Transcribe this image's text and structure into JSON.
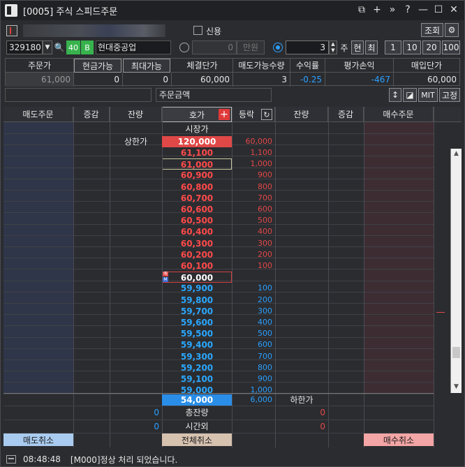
{
  "window": {
    "id": "[0005]",
    "title": "주식 스피드주문"
  },
  "toolbar": {
    "credit_label": "신용",
    "query_button": "조회"
  },
  "stock": {
    "code": "329180",
    "badge_margin": "40",
    "badge_type": "B",
    "name": "현대중공업"
  },
  "order_input": {
    "amount_value": "0",
    "amount_unit": "만원",
    "qty_value": "3",
    "qty_unit": "주",
    "btn_current": "현",
    "btn_max": "최",
    "qty_presets": [
      "1",
      "10",
      "20",
      "100"
    ]
  },
  "summary": {
    "headers": [
      "주문가",
      "현금가능",
      "최대가능",
      "체결단가",
      "매도가능수량",
      "수익률",
      "평가손익",
      "매입단가"
    ],
    "values": [
      "61,000",
      "0",
      "0",
      "60,000",
      "3",
      "-0.25",
      "-467",
      "60,000"
    ]
  },
  "order_amount_label": "주문금액",
  "mode_buttons": [
    "MIT",
    "고정"
  ],
  "grid": {
    "headers": [
      "매도주문",
      "증감",
      "잔량",
      "호가",
      "등락",
      "잔량",
      "증감",
      "매수주문"
    ],
    "market_label": "시장가",
    "upper_label": "상한가",
    "lower_label": "하한가",
    "upper_price": "120,000",
    "upper_change": "60,000",
    "current_price": "60,000",
    "current_marker_top": "매",
    "current_marker_bottom": "M",
    "asks": [
      {
        "price": "61,100",
        "change": "1,100"
      },
      {
        "price": "61,000",
        "change": "1,000"
      },
      {
        "price": "60,900",
        "change": "900"
      },
      {
        "price": "60,800",
        "change": "800"
      },
      {
        "price": "60,700",
        "change": "700"
      },
      {
        "price": "60,600",
        "change": "600"
      },
      {
        "price": "60,500",
        "change": "500"
      },
      {
        "price": "60,400",
        "change": "400"
      },
      {
        "price": "60,300",
        "change": "300"
      },
      {
        "price": "60,200",
        "change": "200"
      },
      {
        "price": "60,100",
        "change": "100"
      }
    ],
    "bids": [
      {
        "price": "59,900",
        "change": "100"
      },
      {
        "price": "59,800",
        "change": "200"
      },
      {
        "price": "59,700",
        "change": "300"
      },
      {
        "price": "59,600",
        "change": "400"
      },
      {
        "price": "59,500",
        "change": "500"
      },
      {
        "price": "59,400",
        "change": "600"
      },
      {
        "price": "59,300",
        "change": "700"
      },
      {
        "price": "59,200",
        "change": "800"
      },
      {
        "price": "59,100",
        "change": "900"
      },
      {
        "price": "59,000",
        "change": "1,000"
      }
    ],
    "lower_price": "54,000",
    "lower_change": "6,000",
    "total_label": "총잔량",
    "total_ask": "0",
    "total_bid": "0",
    "after_label": "시간외",
    "after_ask": "0",
    "after_bid": "0",
    "cancel_sell": "매도취소",
    "cancel_all": "전체취소",
    "cancel_buy": "매수취소"
  },
  "status": {
    "time": "08:48:48",
    "message": "[M000]정상 처리 되었습니다."
  },
  "colors": {
    "ask": "#ff4a4a",
    "bid": "#2aa8ff",
    "upper_bg": "#e04848",
    "lower_bg": "#2a8ee8",
    "cancel_sell_bg": "#a9cbef",
    "cancel_all_bg": "#d7c2b0",
    "cancel_buy_bg": "#f4a5a5",
    "badge_green": "#37b24d"
  }
}
